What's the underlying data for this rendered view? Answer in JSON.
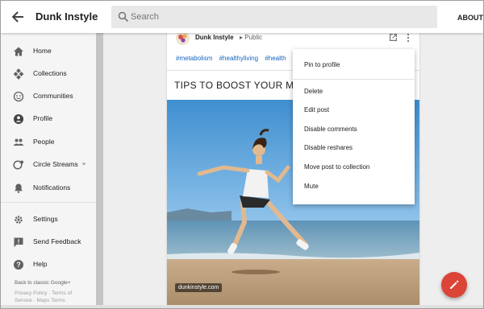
{
  "header": {
    "app_title": "Dunk Instyle",
    "search_placeholder": "Search",
    "about_label": "ABOUT"
  },
  "sidebar": {
    "items": [
      {
        "label": "Home",
        "icon": "home-icon"
      },
      {
        "label": "Collections",
        "icon": "collections-icon"
      },
      {
        "label": "Communities",
        "icon": "communities-icon"
      },
      {
        "label": "Profile",
        "icon": "profile-icon"
      },
      {
        "label": "People",
        "icon": "people-icon"
      },
      {
        "label": "Circle Streams",
        "icon": "circle-streams-icon"
      },
      {
        "label": "Notifications",
        "icon": "bell-icon"
      },
      {
        "label": "Settings",
        "icon": "gear-icon"
      },
      {
        "label": "Send Feedback",
        "icon": "feedback-icon"
      },
      {
        "label": "Help",
        "icon": "help-icon"
      }
    ],
    "back_to_classic": "Back to classic Google+",
    "policy_links": "Privacy Policy · Terms of",
    "policy_links_2": "Service · Maps Terms"
  },
  "post": {
    "author": "Dunk Instyle",
    "visibility": "Public",
    "hashtags": [
      "#metabolism",
      "#healthyliving",
      "#health"
    ],
    "title": "TIPS TO BOOST YOUR METABOLISM",
    "watermark": "dunkinstyle.com"
  },
  "menu": {
    "items": [
      "Pin to profile",
      "Delete",
      "Edit post",
      "Disable comments",
      "Disable reshares",
      "Move post to collection",
      "Mute"
    ]
  },
  "colors": {
    "accent_red": "#db4437",
    "link_blue": "#1565c0",
    "sidebar_bg": "#f5f5f5",
    "main_bg": "#eeeeee"
  }
}
